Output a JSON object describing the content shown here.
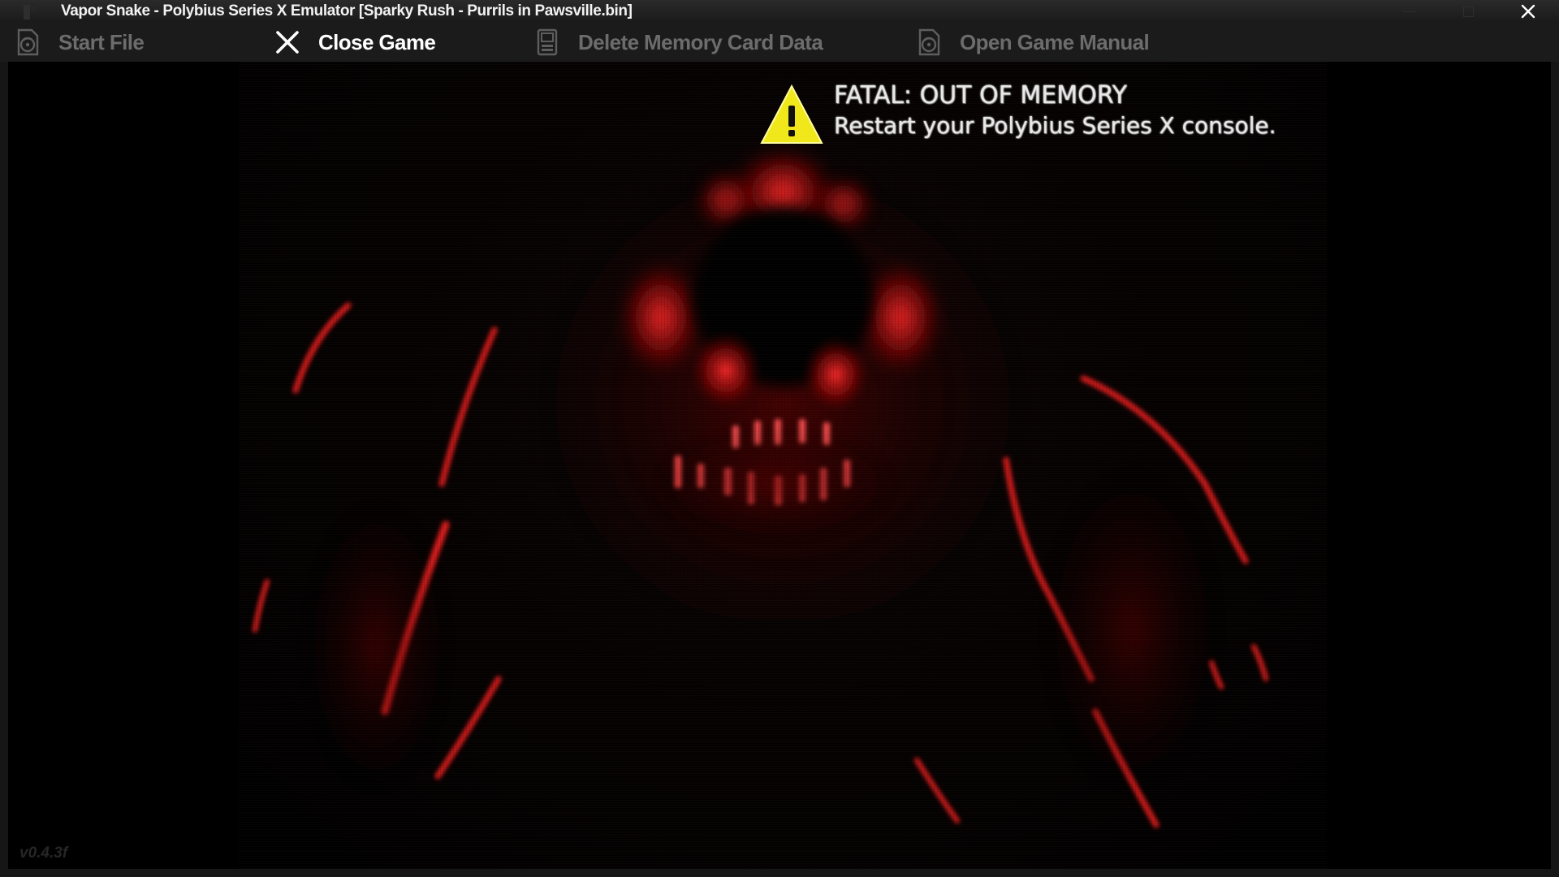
{
  "window": {
    "title": "Vapor Snake - Polybius Series X Emulator [Sparky Rush - Purrils in Pawsville.bin]",
    "app_icon": "gamepad-icon",
    "controls": [
      "minimize-icon",
      "maximize-icon",
      "close-icon"
    ]
  },
  "toolbar": {
    "items": [
      {
        "label": "Start File",
        "icon": "disc-file-icon",
        "active": false
      },
      {
        "label": "Close Game",
        "icon": "x-icon",
        "active": true
      },
      {
        "label": "Delete Memory Card Data",
        "icon": "memory-card-icon",
        "active": false
      },
      {
        "label": "Open Game Manual",
        "icon": "manual-disc-icon",
        "active": false
      }
    ]
  },
  "game": {
    "error": {
      "icon": "warning-triangle-icon",
      "line1": "FATAL: OUT OF MEMORY",
      "line2": "Restart your Polybius Series X console."
    },
    "version": "v0.4.3f"
  },
  "colors": {
    "accent_red": "#d41414",
    "warning_yellow": "#f0e81a",
    "active_text": "#ffffff",
    "inactive_text": "#6c6c6c"
  }
}
